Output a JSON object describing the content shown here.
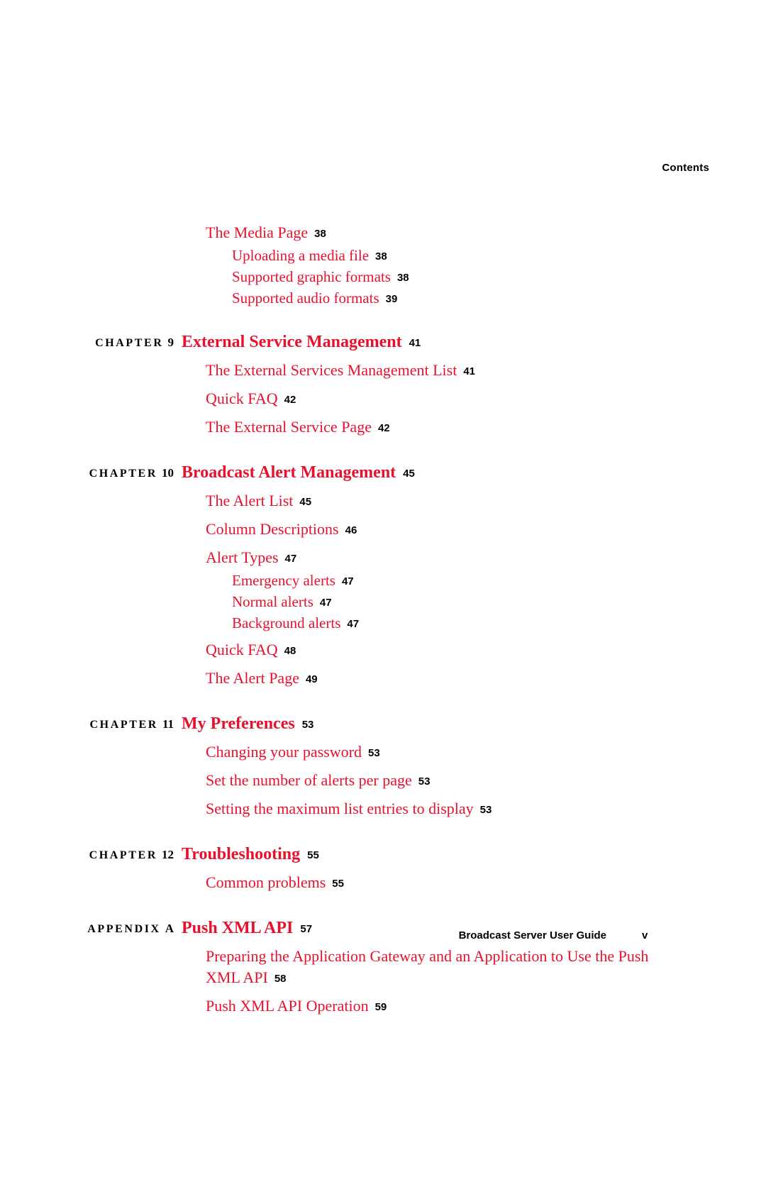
{
  "running_head": "Contents",
  "colors": {
    "entry_red": "#e8112d",
    "text_black": "#000000",
    "page_background": "#ffffff"
  },
  "toc": {
    "leading_entries": [
      {
        "level": 1,
        "label": "The Media Page",
        "page": "38"
      },
      {
        "level": 2,
        "label": "Uploading a media file",
        "page": "38"
      },
      {
        "level": 2,
        "label": "Supported graphic formats",
        "page": "38"
      },
      {
        "level": 2,
        "label": "Supported audio formats",
        "page": "39"
      }
    ],
    "sections": [
      {
        "kind_label": "CHAPTER",
        "number": "9",
        "title": "External Service Management",
        "page": "41",
        "entries": [
          {
            "level": 1,
            "label": "The External Services Management List",
            "page": "41"
          },
          {
            "level": 1,
            "label": "Quick FAQ",
            "page": "42"
          },
          {
            "level": 1,
            "label": "The External Service Page",
            "page": "42"
          }
        ]
      },
      {
        "kind_label": "CHAPTER",
        "number": "10",
        "title": "Broadcast Alert Management",
        "page": "45",
        "entries": [
          {
            "level": 1,
            "label": "The Alert List",
            "page": "45"
          },
          {
            "level": 1,
            "label": "Column Descriptions",
            "page": "46"
          },
          {
            "level": 1,
            "label": "Alert Types",
            "page": "47"
          },
          {
            "level": 2,
            "label": "Emergency alerts",
            "page": "47"
          },
          {
            "level": 2,
            "label": "Normal alerts",
            "page": "47"
          },
          {
            "level": 2,
            "label": "Background alerts",
            "page": "47"
          },
          {
            "level": 1,
            "label": "Quick FAQ",
            "page": "48"
          },
          {
            "level": 1,
            "label": "The Alert Page",
            "page": "49"
          }
        ]
      },
      {
        "kind_label": "CHAPTER",
        "number": "11",
        "title": "My Preferences",
        "page": "53",
        "entries": [
          {
            "level": 1,
            "label": "Changing your password",
            "page": "53"
          },
          {
            "level": 1,
            "label": "Set the number of alerts per page",
            "page": "53"
          },
          {
            "level": 1,
            "label": "Setting the maximum list entries to display",
            "page": "53"
          }
        ]
      },
      {
        "kind_label": "CHAPTER",
        "number": "12",
        "title": "Troubleshooting",
        "page": "55",
        "entries": [
          {
            "level": 1,
            "label": "Common problems",
            "page": "55"
          }
        ]
      },
      {
        "kind_label": "APPENDIX",
        "number": "A",
        "title": "Push XML API",
        "page": "57",
        "entries": [
          {
            "level": 1,
            "label": "Preparing the Application Gateway and an Application to Use the Push XML API",
            "page": "58"
          },
          {
            "level": 1,
            "label": "Push XML API Operation",
            "page": "59"
          }
        ]
      }
    ]
  },
  "footer": {
    "title": "Broadcast Server User Guide",
    "page_number": "v"
  }
}
